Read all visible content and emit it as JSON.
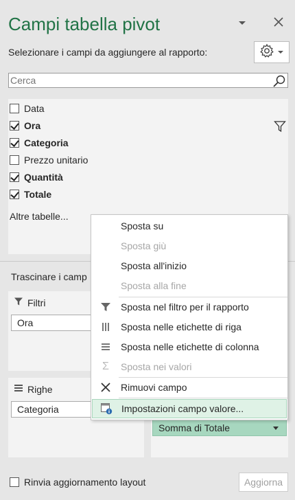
{
  "panel": {
    "title": "Campi tabella pivot",
    "subtitle": "Selezionare i campi da aggiungere al rapporto:",
    "dropdown_icon": "chevron-down-icon",
    "close_icon": "close-icon",
    "tools_icon": "gear-icon"
  },
  "search": {
    "placeholder": "Cerca",
    "value": ""
  },
  "fields": [
    {
      "label": "Data",
      "checked": false
    },
    {
      "label": "Ora",
      "checked": true
    },
    {
      "label": "Categoria",
      "checked": true
    },
    {
      "label": "Prezzo unitario",
      "checked": false
    },
    {
      "label": "Quantità",
      "checked": true
    },
    {
      "label": "Totale",
      "checked": true
    }
  ],
  "more_tables": "Altre tabelle...",
  "drag_hint": "Trascinare i camp",
  "areas": {
    "filters": {
      "title": "Filtri",
      "items": [
        "Ora"
      ]
    },
    "rows": {
      "title": "Righe",
      "items": [
        "Categoria"
      ]
    },
    "values": {
      "items": [
        "Somma di Totale"
      ]
    }
  },
  "context_menu": [
    {
      "label": "Sposta su",
      "disabled": false,
      "icon": ""
    },
    {
      "label": "Sposta giù",
      "disabled": true,
      "icon": ""
    },
    {
      "label": "Sposta all'inizio",
      "disabled": false,
      "icon": ""
    },
    {
      "label": "Sposta alla fine",
      "disabled": true,
      "icon": ""
    },
    {
      "label": "Sposta nel filtro per il rapporto",
      "disabled": false,
      "icon": "filter-icon"
    },
    {
      "label": "Sposta nelle etichette di riga",
      "disabled": false,
      "icon": "row-labels-icon"
    },
    {
      "label": "Sposta nelle etichette di colonna",
      "disabled": false,
      "icon": "column-labels-icon"
    },
    {
      "label": "Sposta nei valori",
      "disabled": true,
      "icon": "sigma-icon"
    },
    {
      "label": "Rimuovi campo",
      "disabled": false,
      "icon": "remove-x-icon"
    },
    {
      "label": "Impostazioni campo valore...",
      "disabled": false,
      "highlighted": true,
      "icon": "field-settings-icon"
    }
  ],
  "footer": {
    "defer_label": "Rinvia aggiornamento layout",
    "defer_checked": false,
    "update_label": "Aggiorna",
    "update_disabled": true
  },
  "colors": {
    "title": "#217346",
    "accent_value": "#a7d7bf",
    "menu_highlight": "#dff2e6"
  }
}
